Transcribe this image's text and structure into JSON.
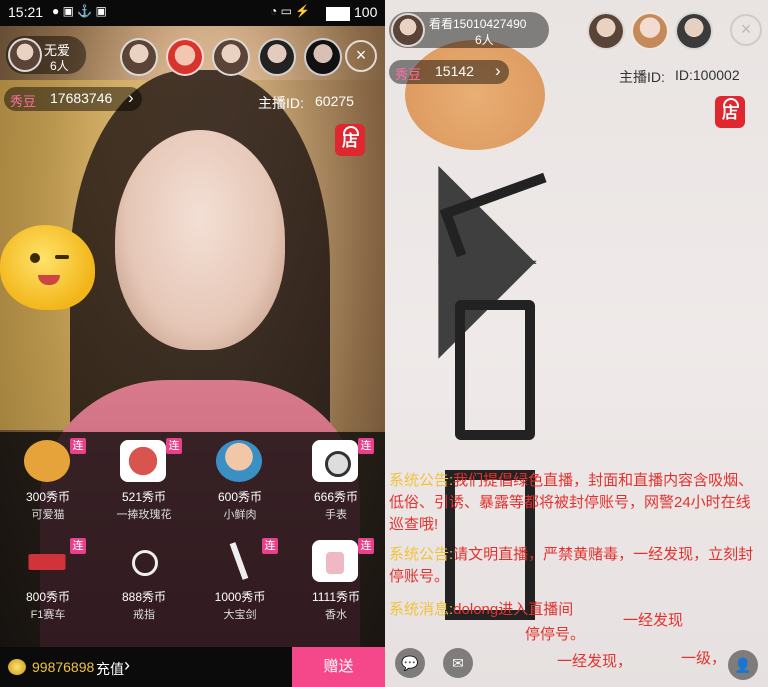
{
  "left": {
    "status": {
      "time": "15:21",
      "battery": "100"
    },
    "host": {
      "name": "无爱",
      "count": "6人"
    },
    "xiudou_label": "秀豆",
    "xiudou_value": "17683746",
    "anchor_id_label": "主播ID:",
    "anchor_id_value": "60275",
    "shop_label": "店",
    "close_icon": "×",
    "gifts": [
      {
        "price": "300秀币",
        "name": "可爱猫",
        "badge": "连",
        "color": "#e6a33a"
      },
      {
        "price": "521秀币",
        "name": "一捧玫瑰花",
        "badge": "连",
        "color": "#c9403b"
      },
      {
        "price": "600秀币",
        "name": "小鲜肉",
        "badge": "",
        "color": "#3a8fc4"
      },
      {
        "price": "666秀币",
        "name": "手表",
        "badge": "连",
        "color": "#d9d9d9"
      },
      {
        "price": "800秀币",
        "name": "F1赛车",
        "badge": "连",
        "color": "#d0343a"
      },
      {
        "price": "888秀币",
        "name": "戒指",
        "badge": "",
        "color": "#e8e8e8"
      },
      {
        "price": "1000秀币",
        "name": "大宝剑",
        "badge": "连",
        "color": "#e8e8e8"
      },
      {
        "price": "1111秀币",
        "name": "香水",
        "badge": "连",
        "color": "#f0b7c4"
      }
    ],
    "balance": "99876898",
    "recharge": "充值",
    "send": "赠送",
    "chevron": "›"
  },
  "right": {
    "host": {
      "name": "看看15010427490",
      "count": "6人"
    },
    "xiudou_label": "秀豆",
    "xiudou_value": "15142",
    "anchor_id_label": "主播ID:",
    "anchor_id_value": "ID:100002",
    "shop_label": "店",
    "close_icon": "×",
    "notices": [
      {
        "tag": "系统公告:",
        "text": "我们提倡绿色直播，封面和直播内容含吸烟、低俗、引诱、暴露等都将被封停账号，网警24小时在线巡查哦!"
      },
      {
        "tag": "系统公告:",
        "text": "请文明直播，严禁黄赌毒，一经发现，立刻封停账号。"
      },
      {
        "tag": "系统消息:",
        "text": "dolong进入直播间"
      }
    ],
    "fragments": [
      "停停号。",
      "一经发现",
      "一经发现，",
      "一级，"
    ],
    "chat_icon": "💬",
    "mail_icon": "✉",
    "user_icon": "👤"
  }
}
